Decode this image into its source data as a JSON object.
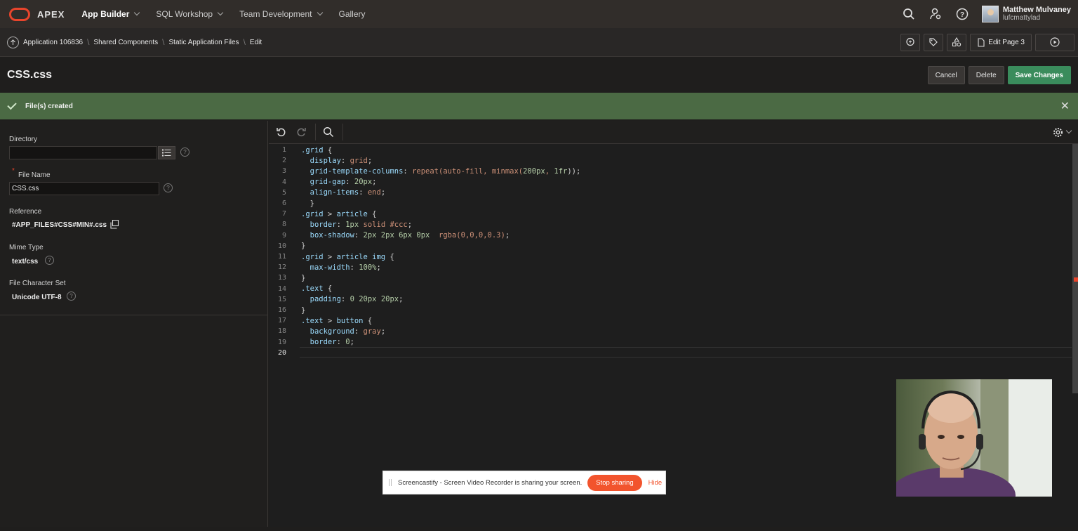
{
  "topnav": {
    "logo_text": "APEX",
    "menu": [
      {
        "label": "App Builder",
        "active": true,
        "has_menu": true
      },
      {
        "label": "SQL Workshop",
        "active": false,
        "has_menu": true
      },
      {
        "label": "Team Development",
        "active": false,
        "has_menu": true
      },
      {
        "label": "Gallery",
        "active": false,
        "has_menu": false
      }
    ],
    "user_name": "Matthew Mulvaney",
    "user_id": "lufcmattylad"
  },
  "breadcrumb": {
    "items": [
      "Application 106836",
      "Shared Components",
      "Static Application Files",
      "Edit"
    ],
    "edit_page_label": "Edit Page 3"
  },
  "page": {
    "title": "CSS.css",
    "cancel_label": "Cancel",
    "delete_label": "Delete",
    "save_label": "Save Changes"
  },
  "message": {
    "text": "File(s) created"
  },
  "form": {
    "directory_label": "Directory",
    "directory_value": "",
    "file_name_label": "File Name",
    "file_name_value": "CSS.css",
    "reference_label": "Reference",
    "reference_value": "#APP_FILES#CSS#MIN#.css",
    "mime_label": "Mime Type",
    "mime_value": "text/css",
    "charset_label": "File Character Set",
    "charset_value": "Unicode UTF-8"
  },
  "editor": {
    "lines": [
      {
        "n": "1",
        "tokens": [
          [
            ".grid",
            "sel"
          ],
          [
            " {",
            "pun"
          ]
        ]
      },
      {
        "n": "2",
        "tokens": [
          [
            "  display",
            "prop"
          ],
          [
            ": ",
            "pun"
          ],
          [
            "grid",
            "vl"
          ],
          [
            ";",
            "pun"
          ]
        ]
      },
      {
        "n": "3",
        "tokens": [
          [
            "  grid-template-columns",
            "prop"
          ],
          [
            ": ",
            "pun"
          ],
          [
            "repeat(auto-fill, minmax(",
            "vl"
          ],
          [
            "200px",
            "num"
          ],
          [
            ", ",
            "vl"
          ],
          [
            "1fr",
            "num"
          ],
          [
            "));",
            "pun"
          ]
        ]
      },
      {
        "n": "4",
        "tokens": [
          [
            "  grid-gap",
            "prop"
          ],
          [
            ": ",
            "pun"
          ],
          [
            "20px",
            "num"
          ],
          [
            ";",
            "pun"
          ]
        ]
      },
      {
        "n": "5",
        "tokens": [
          [
            "  align-items",
            "prop"
          ],
          [
            ": ",
            "pun"
          ],
          [
            "end",
            "vl"
          ],
          [
            ";",
            "pun"
          ]
        ]
      },
      {
        "n": "6",
        "tokens": [
          [
            "  }",
            "pun"
          ]
        ]
      },
      {
        "n": "7",
        "tokens": [
          [
            ".grid",
            "sel"
          ],
          [
            " > ",
            "pun"
          ],
          [
            "article",
            "sel"
          ],
          [
            " {",
            "pun"
          ]
        ]
      },
      {
        "n": "8",
        "tokens": [
          [
            "  border",
            "prop"
          ],
          [
            ": ",
            "pun"
          ],
          [
            "1px",
            "num"
          ],
          [
            " ",
            "pun"
          ],
          [
            "solid",
            "vl"
          ],
          [
            " #ccc",
            "vl"
          ],
          [
            ";",
            "pun"
          ]
        ]
      },
      {
        "n": "9",
        "tokens": [
          [
            "  box-shadow",
            "prop"
          ],
          [
            ": ",
            "pun"
          ],
          [
            "2px 2px 6px 0px",
            "num"
          ],
          [
            "  ",
            "pun"
          ],
          [
            "rgba(0,0,0,0.3)",
            "vl"
          ],
          [
            ";",
            "pun"
          ]
        ]
      },
      {
        "n": "10",
        "tokens": [
          [
            "}",
            "pun"
          ]
        ]
      },
      {
        "n": "11",
        "tokens": [
          [
            ".grid",
            "sel"
          ],
          [
            " > ",
            "pun"
          ],
          [
            "article img",
            "sel"
          ],
          [
            " {",
            "pun"
          ]
        ]
      },
      {
        "n": "12",
        "tokens": [
          [
            "  max-width",
            "prop"
          ],
          [
            ": ",
            "pun"
          ],
          [
            "100%",
            "num"
          ],
          [
            ";",
            "pun"
          ]
        ]
      },
      {
        "n": "13",
        "tokens": [
          [
            "}",
            "pun"
          ]
        ]
      },
      {
        "n": "14",
        "tokens": [
          [
            ".text",
            "sel"
          ],
          [
            " {",
            "pun"
          ]
        ]
      },
      {
        "n": "15",
        "tokens": [
          [
            "  padding",
            "prop"
          ],
          [
            ": ",
            "pun"
          ],
          [
            "0 20px 20px",
            "num"
          ],
          [
            ";",
            "pun"
          ]
        ]
      },
      {
        "n": "16",
        "tokens": [
          [
            "}",
            "pun"
          ]
        ]
      },
      {
        "n": "17",
        "tokens": [
          [
            ".text",
            "sel"
          ],
          [
            " > ",
            "pun"
          ],
          [
            "button",
            "sel"
          ],
          [
            " {",
            "pun"
          ]
        ]
      },
      {
        "n": "18",
        "tokens": [
          [
            "  background",
            "prop"
          ],
          [
            ": ",
            "pun"
          ],
          [
            "gray",
            "vl"
          ],
          [
            ";",
            "pun"
          ]
        ]
      },
      {
        "n": "19",
        "tokens": [
          [
            "  border",
            "prop"
          ],
          [
            ": ",
            "pun"
          ],
          [
            "0",
            "num"
          ],
          [
            ";",
            "pun"
          ]
        ]
      },
      {
        "n": "20",
        "tokens": []
      }
    ]
  },
  "sharebar": {
    "text": "Screencastify - Screen Video Recorder is sharing your screen.",
    "stop_label": "Stop sharing",
    "hide_label": "Hide"
  },
  "colors": {
    "accent": "#e8452c",
    "primary_button": "#3a8c5c",
    "success_bg": "#4b6a44"
  }
}
